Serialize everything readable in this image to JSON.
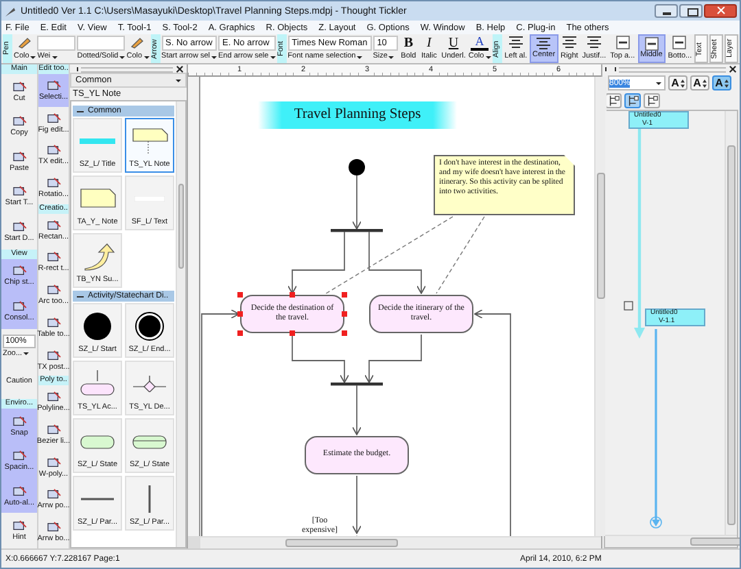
{
  "window": {
    "title": "Untitled0 Ver 1.1 C:\\Users\\Masayuki\\Desktop\\Travel Planning Steps.mdpj - Thought Tickler"
  },
  "menu": [
    "F. File",
    "E. Edit",
    "V. View",
    "T. Tool-1",
    "S. Tool-2",
    "A. Graphics",
    "R. Objects",
    "Z. Layout",
    "G. Options",
    "W. Window",
    "B. Help",
    "C. Plug-in",
    "The others"
  ],
  "toolbar": [
    {
      "kind": "label",
      "text": "Pen"
    },
    {
      "kind": "icon",
      "caption": "Colo"
    },
    {
      "kind": "blank",
      "caption": "Wei"
    },
    {
      "kind": "blank",
      "caption": "Dotted/Solid"
    },
    {
      "kind": "icon",
      "caption": "Colo"
    },
    {
      "kind": "label",
      "text": "Arrow"
    },
    {
      "kind": "field",
      "value": "S. No arrow",
      "caption": "Start arrow sel"
    },
    {
      "kind": "field",
      "value": "E. No arrow",
      "caption": "End arrow sele"
    },
    {
      "kind": "label",
      "text": "Font"
    },
    {
      "kind": "field",
      "value": "Times New Roman",
      "caption": "Font name selection"
    },
    {
      "kind": "field",
      "value": "10",
      "caption": "Size"
    },
    {
      "kind": "glyph",
      "glyph": "B",
      "caption": "Bold"
    },
    {
      "kind": "glyph",
      "glyph": "I",
      "caption": "Italic"
    },
    {
      "kind": "glyph",
      "glyph": "U",
      "caption": "Underl."
    },
    {
      "kind": "color",
      "glyph": "A",
      "caption": "Colo"
    },
    {
      "kind": "label",
      "text": "Align"
    },
    {
      "kind": "align",
      "caption": "Left al.",
      "selected": false
    },
    {
      "kind": "align",
      "caption": "Center",
      "selected": true
    },
    {
      "kind": "align",
      "caption": "Right",
      "selected": false
    },
    {
      "kind": "align",
      "caption": "Justif...",
      "selected": false
    },
    {
      "kind": "valign",
      "caption": "Top a...",
      "selected": false
    },
    {
      "kind": "valign",
      "caption": "Middle",
      "selected": true
    },
    {
      "kind": "valign",
      "caption": "Botto...",
      "selected": false
    }
  ],
  "side_tabs": [
    "Text",
    "Sheet",
    "Layer"
  ],
  "main_column": [
    {
      "kind": "header",
      "label": "Main"
    },
    {
      "kind": "tool",
      "label": "Cut",
      "selected": false
    },
    {
      "kind": "tool",
      "label": "Copy",
      "selected": false
    },
    {
      "kind": "tool",
      "label": "Paste",
      "selected": false
    },
    {
      "kind": "tool",
      "label": "Start T...",
      "selected": false
    },
    {
      "kind": "tool",
      "label": "Start D...",
      "selected": false
    },
    {
      "kind": "header",
      "label": "View"
    },
    {
      "kind": "tool",
      "label": "Chip st...",
      "selected": true
    },
    {
      "kind": "tool",
      "label": "Consol...",
      "selected": true
    },
    {
      "kind": "zoom",
      "value": "100%",
      "label": "Zoo..."
    },
    {
      "kind": "plain",
      "label": "Caution"
    },
    {
      "kind": "header",
      "label": "Enviro..."
    },
    {
      "kind": "tool",
      "label": "Snap",
      "selected": true
    },
    {
      "kind": "tool",
      "label": "Spacin...",
      "selected": true
    },
    {
      "kind": "tool",
      "label": "Auto-al...",
      "selected": true
    },
    {
      "kind": "tool",
      "label": "Hint",
      "selected": false
    }
  ],
  "edit_column": [
    {
      "kind": "header",
      "label": "Edit too.."
    },
    {
      "kind": "tool",
      "label": "Selecti...",
      "selected": true
    },
    {
      "kind": "tool",
      "label": "Fig edit...",
      "selected": false
    },
    {
      "kind": "tool",
      "label": "TX edit...",
      "selected": false
    },
    {
      "kind": "tool",
      "label": "Rotatio...",
      "selected": false
    },
    {
      "kind": "header",
      "label": "Creatio.."
    },
    {
      "kind": "tool",
      "label": "Rectan...",
      "selected": false
    },
    {
      "kind": "tool",
      "label": "R-rect t...",
      "selected": false
    },
    {
      "kind": "tool",
      "label": "Arc too...",
      "selected": false
    },
    {
      "kind": "tool",
      "label": "Table to...",
      "selected": false
    },
    {
      "kind": "tool",
      "label": "TX post...",
      "selected": false
    },
    {
      "kind": "header",
      "label": "Poly to.."
    },
    {
      "kind": "tool",
      "label": "Polyline...",
      "selected": false
    },
    {
      "kind": "tool",
      "label": "Bezier li...",
      "selected": false
    },
    {
      "kind": "tool",
      "label": "W-poly...",
      "selected": false
    },
    {
      "kind": "tool",
      "label": "Arrw po...",
      "selected": false
    },
    {
      "kind": "tool",
      "label": "Arrw bo...",
      "selected": false
    }
  ],
  "palette": {
    "category": "Common",
    "current": "TS_YL Note",
    "groups": [
      {
        "title": "Common",
        "items": [
          {
            "label": "SZ_L/ Title",
            "kind": "title",
            "selected": false
          },
          {
            "label": "TS_YL Note",
            "kind": "note",
            "selected": true
          },
          {
            "label": "TA_Y_ Note",
            "kind": "note2",
            "selected": false
          },
          {
            "label": "SF_L/ Text",
            "kind": "text",
            "selected": false
          },
          {
            "label": "TB_YN Su...",
            "kind": "arrow",
            "selected": false
          }
        ]
      },
      {
        "title": "Activity/Statechart Di..",
        "items": [
          {
            "label": "SZ_L/ Start",
            "kind": "start",
            "selected": false
          },
          {
            "label": "SZ_L/ End...",
            "kind": "end",
            "selected": false
          },
          {
            "label": "TS_YL Ac...",
            "kind": "action",
            "selected": false
          },
          {
            "label": "TS_YL De...",
            "kind": "decision",
            "selected": false
          },
          {
            "label": "SZ_L/ State",
            "kind": "state",
            "selected": false
          },
          {
            "label": "SZ_L/ State",
            "kind": "state2",
            "selected": false
          },
          {
            "label": "SZ_L/ Par...",
            "kind": "hbar",
            "selected": false
          },
          {
            "label": "SZ_L/ Par...",
            "kind": "vbar",
            "selected": false
          }
        ]
      }
    ]
  },
  "canvas": {
    "ruler": [
      "1",
      "2",
      "3",
      "4",
      "5",
      "6"
    ],
    "title": "Travel Planning Steps",
    "note": "I don't have interest in the destination, and my wife doesn't have interest in the itinerary. So this activity can be splited into two activities.",
    "nodes": [
      {
        "text": "Decide the destination of the travel.",
        "selected": true
      },
      {
        "text": "Decide the itinerary of the travel.",
        "selected": false
      },
      {
        "text": "Estimate the budget.",
        "selected": false
      }
    ],
    "guard": "[Too expensive]"
  },
  "version_panel": {
    "zoom": "800%",
    "font_buttons": [
      {
        "glyph": "A",
        "selected": false
      },
      {
        "glyph": "A",
        "selected": false
      },
      {
        "glyph": "A",
        "selected": true
      }
    ],
    "view_buttons": [
      {
        "selected": false
      },
      {
        "selected": true
      },
      {
        "selected": false
      }
    ],
    "nodes": [
      {
        "title": "Untitled0",
        "version": "V-1"
      },
      {
        "title": "Untitled0",
        "version": "V-1.1"
      }
    ]
  },
  "status_bar": {
    "position": "X:0.666667 Y:7.228167 Page:1",
    "date": "April 14, 2010, 6:2 PM"
  }
}
